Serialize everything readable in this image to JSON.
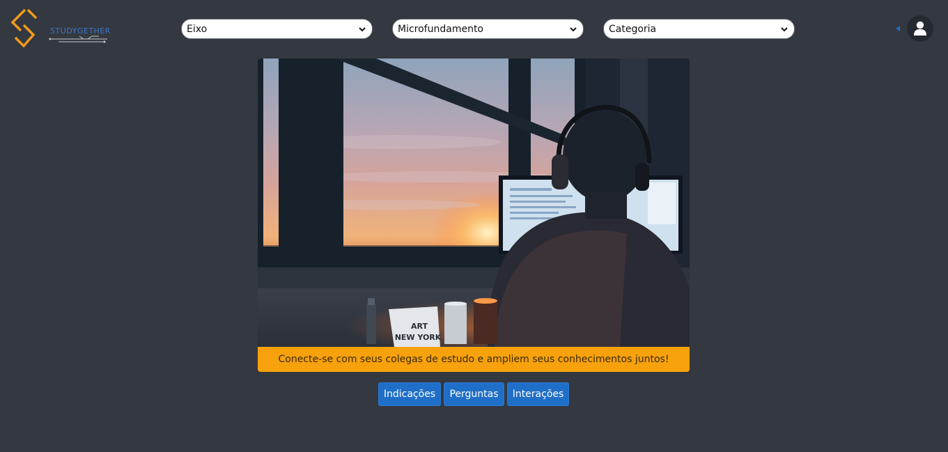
{
  "header": {
    "logo_text": "STUDYGETHER",
    "filters": [
      {
        "label": "Eixo"
      },
      {
        "label": "Microfundamento"
      },
      {
        "label": "Categoria"
      }
    ],
    "collapse_icon": "caret-left-icon",
    "user_icon": "user-icon"
  },
  "hero": {
    "image_alt": "Pessoa com fones de ouvido estudando no computador ao pôr do sol",
    "banner_text": "Conecte-se com seus colegas de estudo e ampliem seus conhecimentos juntos!",
    "mug_text": "ART NEW YORK"
  },
  "actions": [
    {
      "label": "Indicações"
    },
    {
      "label": "Perguntas"
    },
    {
      "label": "Interações"
    }
  ],
  "colors": {
    "background": "#343840",
    "accent_orange": "#f7a10c",
    "button_blue": "#1f6fc8",
    "logo_blue": "#3d77c8"
  }
}
